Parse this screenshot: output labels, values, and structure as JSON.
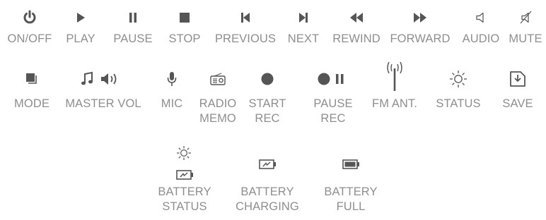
{
  "colors": {
    "icon": "#555555",
    "label": "#8e8e8e"
  },
  "row1": [
    {
      "icon": "power-icon",
      "label": "ON/OFF"
    },
    {
      "icon": "play-icon",
      "label": "PLAY"
    },
    {
      "icon": "pause-icon",
      "label": "PAUSE"
    },
    {
      "icon": "stop-icon",
      "label": "STOP"
    },
    {
      "icon": "previous-icon",
      "label": "PREVIOUS"
    },
    {
      "icon": "next-icon",
      "label": "NEXT"
    },
    {
      "icon": "rewind-icon",
      "label": "REWIND"
    },
    {
      "icon": "forward-icon",
      "label": "FORWARD"
    },
    {
      "icon": "speaker-icon",
      "label": "AUDIO"
    },
    {
      "icon": "mute-icon",
      "label": "MUTE"
    }
  ],
  "row2": [
    {
      "icon": "mode-icon",
      "label": "MODE"
    },
    {
      "icon": "music-volume-icon",
      "label": "MASTER VOL"
    },
    {
      "icon": "microphone-icon",
      "label": "MIC"
    },
    {
      "icon": "radio-icon",
      "label": "RADIO\nMEMO"
    },
    {
      "icon": "record-icon",
      "label": "START\nREC"
    },
    {
      "icon": "record-pause-icon",
      "label": "PAUSE\nREC"
    },
    {
      "icon": "antenna-icon",
      "label": "FM ANT."
    },
    {
      "icon": "sun-icon",
      "label": "STATUS"
    },
    {
      "icon": "save-icon",
      "label": "SAVE"
    }
  ],
  "row3": [
    {
      "icon": "battery-status-icon",
      "label": "BATTERY\nSTATUS"
    },
    {
      "icon": "battery-charging-icon",
      "label": "BATTERY\nCHARGING"
    },
    {
      "icon": "battery-full-icon",
      "label": "BATTERY\nFULL"
    }
  ]
}
